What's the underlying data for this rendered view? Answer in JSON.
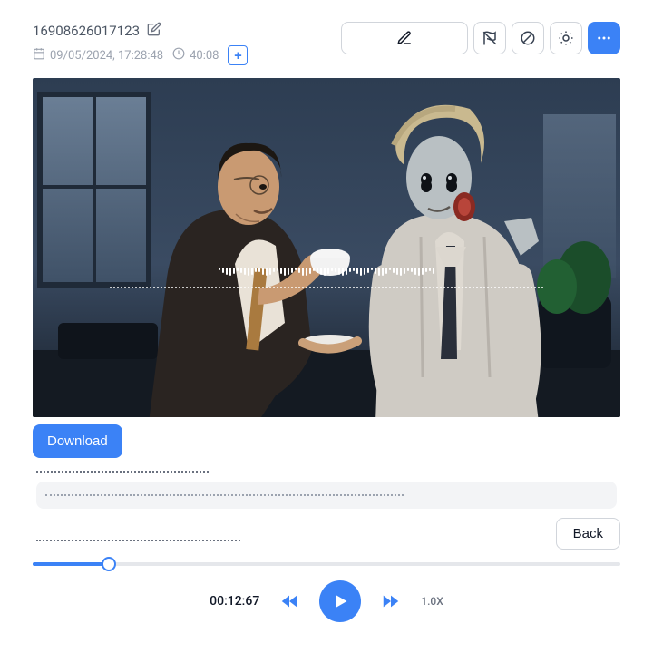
{
  "header": {
    "id": "16908626017123",
    "date": "09/05/2024, 17:28:48",
    "duration": "40:08"
  },
  "buttons": {
    "download": "Download",
    "back": "Back"
  },
  "player": {
    "time": "00:12:67",
    "speed": "1.0X",
    "progress_pct": 13
  }
}
